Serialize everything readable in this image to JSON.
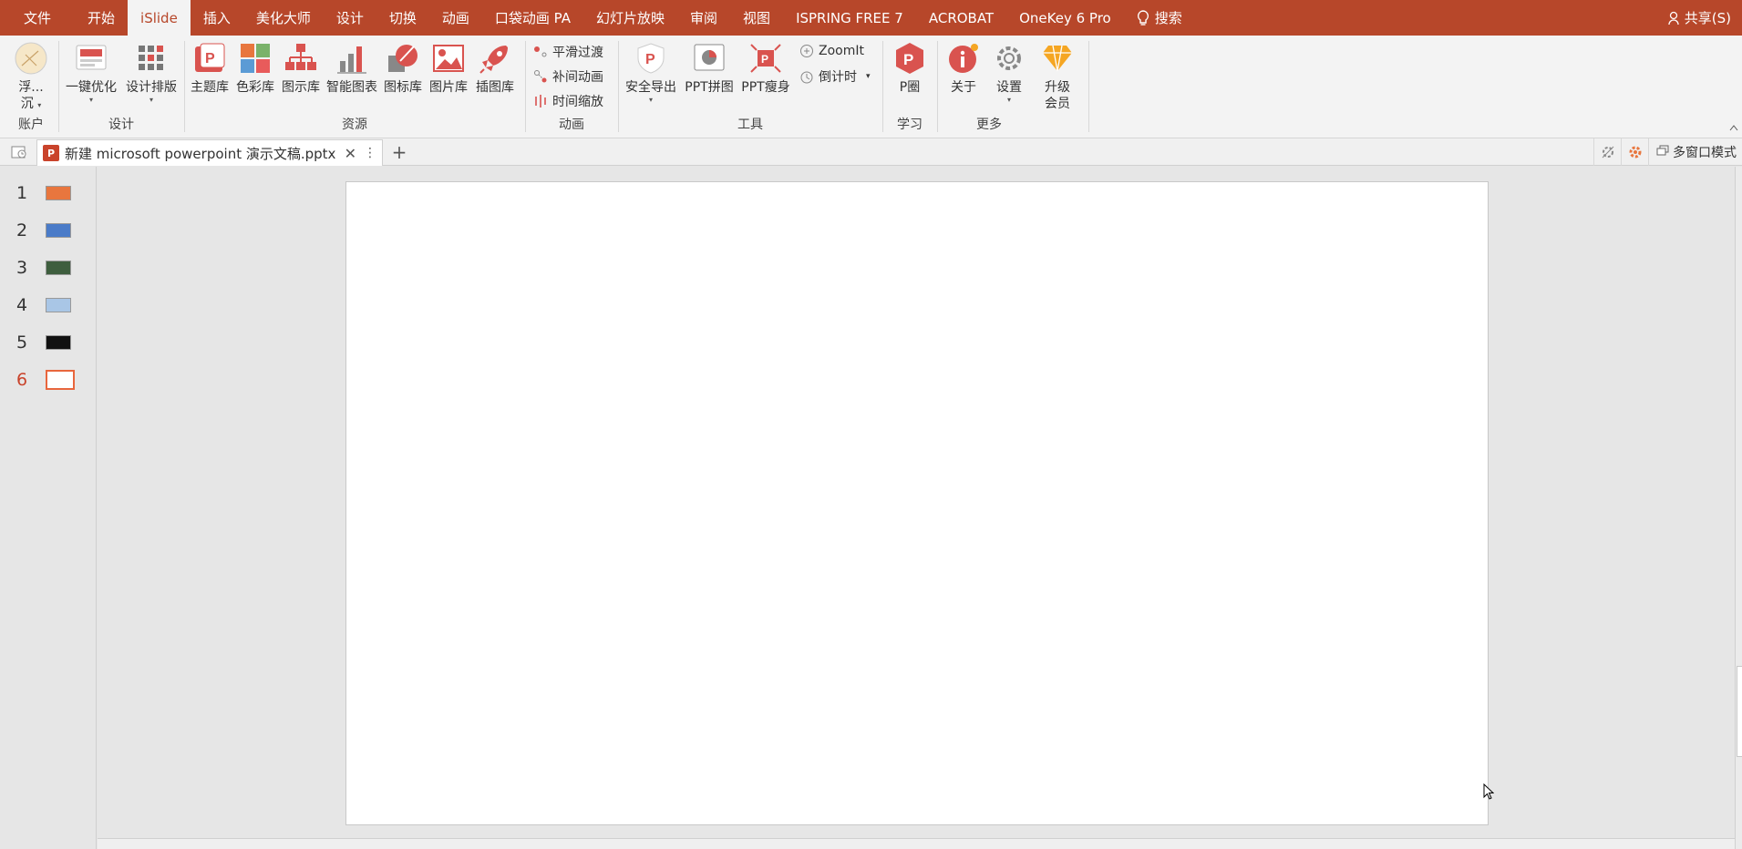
{
  "menubar": {
    "tabs": [
      {
        "label": "文件",
        "active": false
      },
      {
        "label": "开始",
        "active": false
      },
      {
        "label": "iSlide",
        "active": true
      },
      {
        "label": "插入",
        "active": false
      },
      {
        "label": "美化大师",
        "active": false
      },
      {
        "label": "设计",
        "active": false
      },
      {
        "label": "切换",
        "active": false
      },
      {
        "label": "动画",
        "active": false
      },
      {
        "label": "口袋动画 PA",
        "active": false
      },
      {
        "label": "幻灯片放映",
        "active": false
      },
      {
        "label": "审阅",
        "active": false
      },
      {
        "label": "视图",
        "active": false
      },
      {
        "label": "ISPRING FREE 7",
        "active": false
      },
      {
        "label": "ACROBAT",
        "active": false
      },
      {
        "label": "OneKey 6 Pro",
        "active": false
      }
    ],
    "search_label": "搜索",
    "share_label": "共享(S)"
  },
  "ribbon": {
    "groups": {
      "account": "账户",
      "design": "设计",
      "resources": "资源",
      "animation": "动画",
      "tools": "工具",
      "learn": "学习",
      "more": "更多"
    },
    "account_btn": {
      "line1": "浮...",
      "line2": "沉"
    },
    "design_btns": {
      "optimize": "一键优化",
      "layout": "设计排版"
    },
    "resource_btns": {
      "theme": "主题库",
      "color": "色彩库",
      "diagram": "图示库",
      "chart": "智能图表",
      "icon": "图标库",
      "image": "图片库",
      "illustration": "插图库"
    },
    "animation_btns": {
      "smooth": "平滑过渡",
      "tween": "补间动画",
      "timescale": "时间缩放"
    },
    "tool_btns": {
      "export": "安全导出",
      "collage": "PPT拼图",
      "slim": "PPT瘦身",
      "zoomit": "ZoomIt",
      "countdown": "倒计时"
    },
    "learn_btns": {
      "pcircle": "P圈"
    },
    "more_btns": {
      "about": "关于",
      "settings": "设置",
      "upgrade_line1": "升级",
      "upgrade_line2": "会员"
    }
  },
  "docbar": {
    "filename": "新建 microsoft powerpoint 演示文稿.pptx",
    "ppt_badge": "P",
    "multiwindow": "多窗口模式"
  },
  "slides": {
    "items": [
      {
        "num": "1",
        "color": "#e8763e"
      },
      {
        "num": "2",
        "color": "#4a7bc8"
      },
      {
        "num": "3",
        "color": "#3e5e3e"
      },
      {
        "num": "4",
        "color": "#a9c6e6"
      },
      {
        "num": "5",
        "color": "#111111"
      },
      {
        "num": "6",
        "color": "#ffffff"
      }
    ],
    "active_index": 6
  },
  "colors": {
    "accent": "#b7472a",
    "islide_red": "#c9432b",
    "active_slide_border": "#e8663d"
  }
}
